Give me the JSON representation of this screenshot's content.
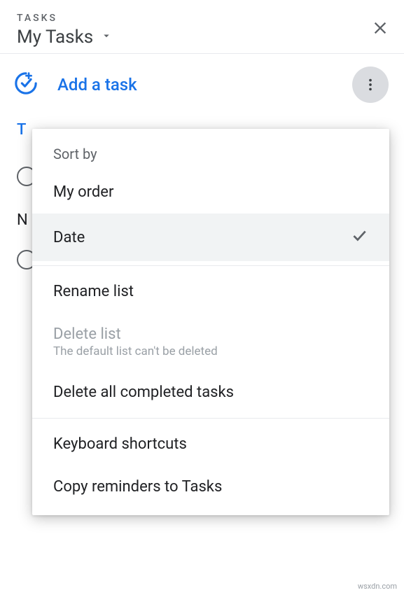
{
  "header": {
    "label": "TASKS",
    "title": "My Tasks"
  },
  "toolbar": {
    "add_task_label": "Add a task"
  },
  "background": {
    "date_label": "T",
    "row_text": "N"
  },
  "menu": {
    "sort_by_heading": "Sort by",
    "my_order": "My order",
    "date": "Date",
    "rename_list": "Rename list",
    "delete_list_title": "Delete list",
    "delete_list_sub": "The default list can't be deleted",
    "delete_completed": "Delete all completed tasks",
    "keyboard_shortcuts": "Keyboard shortcuts",
    "copy_reminders": "Copy reminders to Tasks"
  },
  "watermark": "wsxdn.com"
}
